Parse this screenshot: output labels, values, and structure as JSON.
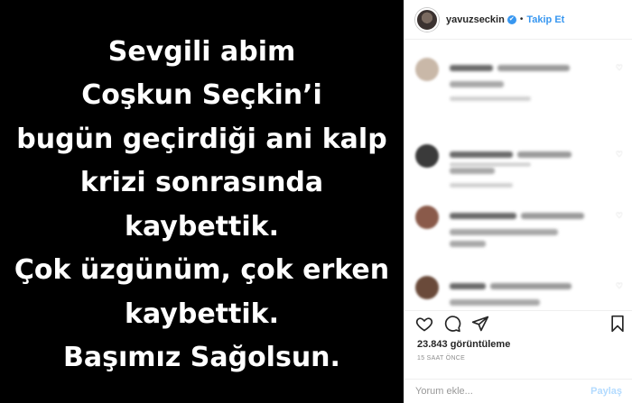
{
  "post": {
    "lines": [
      "Sevgili abim",
      "Coşkun Seçkin’i",
      "bugün geçirdiği ani kalp",
      "krizi sonrasında",
      "kaybettik.",
      "Çok üzgünüm, çok erken",
      "kaybettik.",
      "Başımız Sağolsun."
    ]
  },
  "header": {
    "username": "yavuzseckin",
    "verified_icon": "✔",
    "separator": "•",
    "follow_label": "Takip Et"
  },
  "comments": {
    "items": [
      {
        "avatar_color": "#c9b8a8"
      },
      {
        "avatar_color": "#3a3a3a"
      },
      {
        "avatar_color": "#8a5a4a"
      },
      {
        "avatar_color": "#6a4a3a"
      }
    ]
  },
  "actions": {
    "icons": [
      "heart-icon",
      "comment-icon",
      "share-icon",
      "bookmark-icon"
    ]
  },
  "stats": {
    "views": "23.843 görüntüleme",
    "time_ago": "15 SAAT ÖNCE"
  },
  "add_comment": {
    "placeholder": "Yorum ekle...",
    "post_label": "Paylaş"
  },
  "colors": {
    "accent": "#3897f0",
    "image_bg": "#000000"
  }
}
